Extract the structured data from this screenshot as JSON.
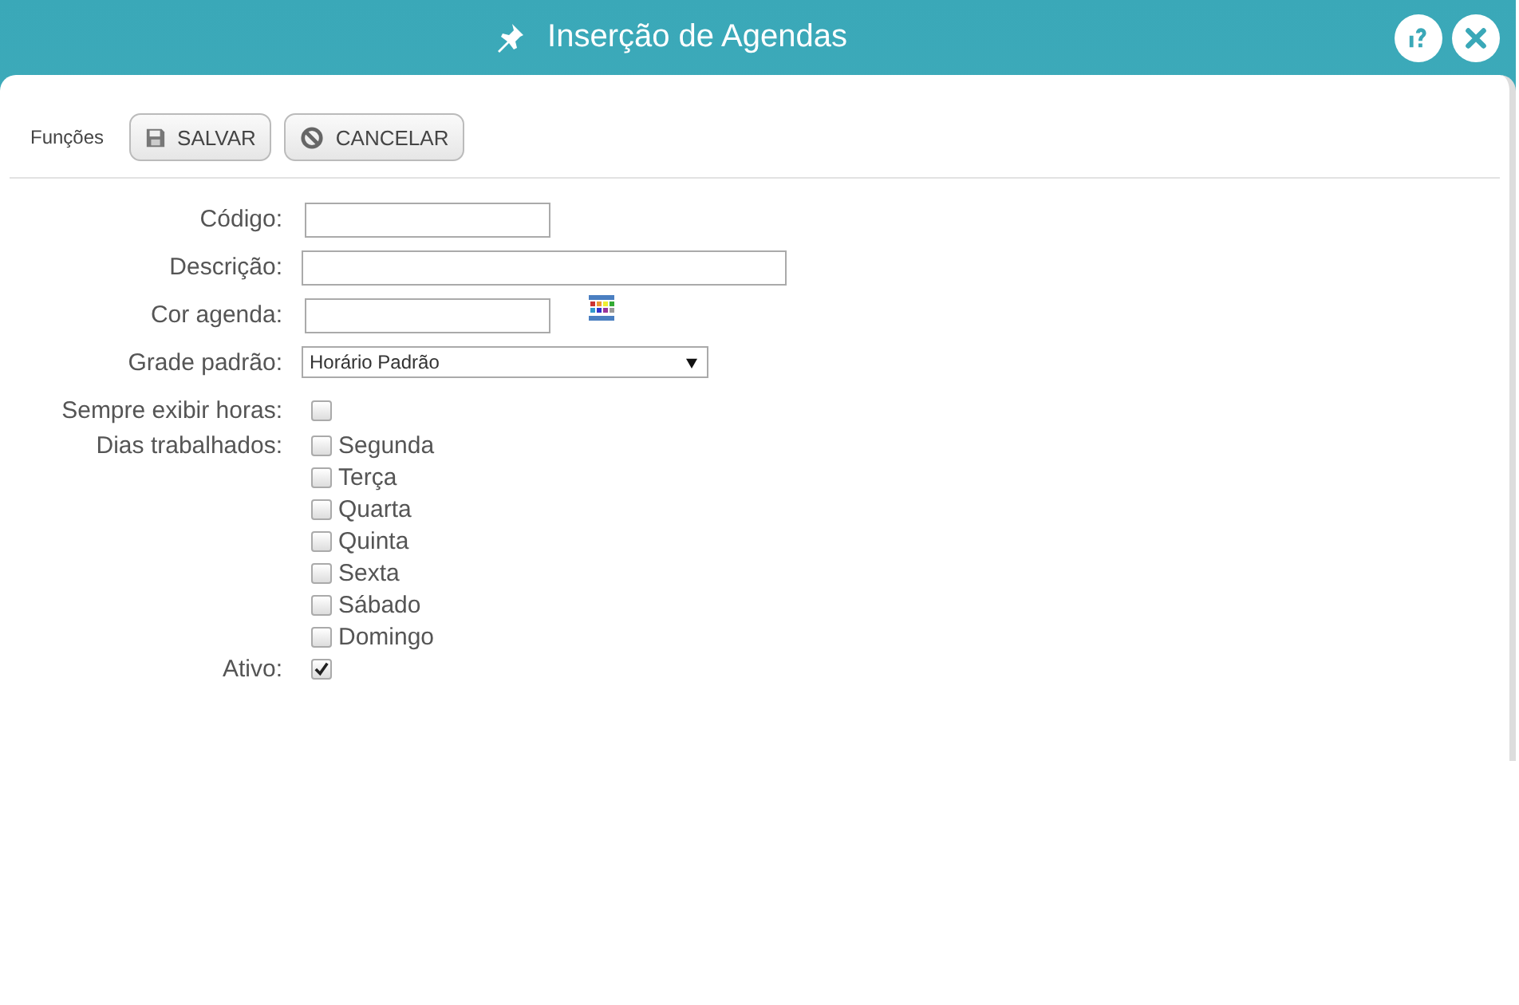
{
  "window": {
    "title": "Inserção de Agendas"
  },
  "toolbar": {
    "label": "Funções",
    "buttons": [
      {
        "kind": "save",
        "label": "SALVAR"
      },
      {
        "kind": "cancel",
        "label": "CANCELAR"
      }
    ]
  },
  "fields": [
    {
      "kind": "text",
      "label": "Código:"
    },
    {
      "kind": "widetext",
      "label": "Descrição:"
    },
    {
      "kind": "color",
      "label": "Cor agenda:"
    },
    {
      "kind": "select",
      "label": "Grade padrão:",
      "value": "Horário Padrão"
    },
    {
      "kind": "checkbox",
      "label": "Sempre exibir horas:",
      "checked": false
    },
    {
      "kind": "checkgroup",
      "label": "Dias trabalhados:",
      "options": [
        {
          "label": "Segunda",
          "checked": false
        },
        {
          "label": "Terça",
          "checked": false
        },
        {
          "label": "Quarta",
          "checked": false
        },
        {
          "label": "Quinta",
          "checked": false
        },
        {
          "label": "Sexta",
          "checked": false
        },
        {
          "label": "Sábado",
          "checked": false
        },
        {
          "label": "Domingo",
          "checked": false
        }
      ]
    },
    {
      "kind": "checkbox",
      "label": "Ativo:",
      "checked": true
    }
  ]
}
